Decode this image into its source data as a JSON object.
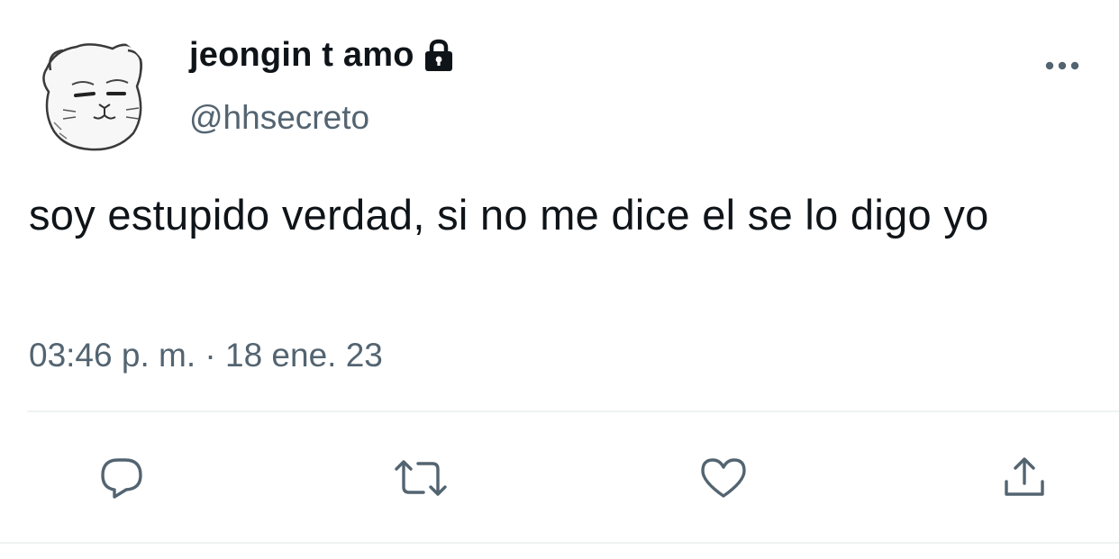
{
  "tweet": {
    "display_name": "jeongin t amo",
    "handle": "@hhsecreto",
    "text": "soy estupido verdad, si no me dice el se lo digo yo",
    "time": "03:46 p. m.",
    "separator": "·",
    "date": "18 ene. 23"
  },
  "icons": {
    "avatar": "cartoon-cat-face-avatar",
    "protected": "lock-icon",
    "more": "more-horizontal-icon",
    "reply": "reply-bubble-icon",
    "retweet": "retweet-icon",
    "like": "heart-icon",
    "share": "share-upload-icon"
  },
  "colors": {
    "text": "#0f1419",
    "secondary": "#536471",
    "divider": "#eff3f4"
  }
}
